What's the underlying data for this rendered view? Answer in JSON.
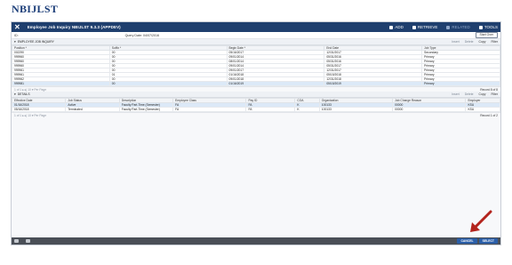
{
  "heading": "NBIJLST",
  "window": {
    "title": "Employee Job Inquiry NBIJLST 9.3.3 (APPDEV)",
    "tools": [
      {
        "label": "ADD",
        "icon": "add-icon",
        "enabled": true
      },
      {
        "label": "RETRIEVE",
        "icon": "retrieve-icon",
        "enabled": true
      },
      {
        "label": "RELATED",
        "icon": "related-icon",
        "enabled": false
      },
      {
        "label": "TOOLS",
        "icon": "gear-icon",
        "enabled": true
      }
    ]
  },
  "keyblock": {
    "id_label": "ID:",
    "query_date": "Query Date: 04/07/2016",
    "start_over": "Start Over"
  },
  "section1": {
    "title": "EMPLOYEE JOB INQUIRY",
    "actions": [
      "Insert",
      "Delete",
      "Copy",
      "Filter"
    ],
    "columns": [
      "Position *",
      "Suffix *",
      "Begin Date *",
      "End Date",
      "Job Type"
    ],
    "rows": [
      [
        "002290",
        "00",
        "05/16/2017",
        "12/31/2017",
        "Secondary"
      ],
      [
        "999960",
        "00",
        "09/01/2014",
        "05/31/2016",
        "Primary"
      ],
      [
        "999960",
        "00",
        "08/01/2014",
        "05/31/2016",
        "Primary"
      ],
      [
        "999960",
        "00",
        "09/01/2014",
        "05/31/2017",
        "Primary"
      ],
      [
        "999961",
        "00",
        "09/01/2017",
        "12/31/2017",
        "Primary"
      ],
      [
        "999961",
        "01",
        "01/16/2018",
        "05/15/2018",
        "Primary"
      ],
      [
        "999962",
        "00",
        "09/01/2018",
        "12/31/2018",
        "Primary"
      ],
      [
        "999981",
        "00",
        "01/16/2019",
        "05/15/2019",
        "Primary"
      ]
    ],
    "pager": "1 of 1 ▸ ▸| 10 ▾ Per Page",
    "record": "Record 8 of 8"
  },
  "section2": {
    "title": "DETAILS",
    "actions": [
      "Insert",
      "Delete",
      "Copy",
      "Filter"
    ],
    "columns": [
      "Effective Date",
      "Job Status",
      "Description",
      "Employee Class",
      "Pay ID",
      "COA",
      "Organization",
      "Job Change Reason",
      "Employer"
    ],
    "rows": [
      [
        "01/16/2018",
        "Active",
        "Faculty Part-Time (Semester)",
        "FA",
        "FA",
        "K",
        "100133",
        "00000",
        "KSU"
      ],
      [
        "05/16/2018",
        "Terminated",
        "Faculty Part-Time (Semester)",
        "FA",
        "FA",
        "K",
        "100133",
        "00000",
        "KSU"
      ]
    ],
    "pager": "1 of 1 ▸ ▸| 10 ▾ Per Page",
    "record": "Record 1 of 2"
  },
  "footer": {
    "cancel": "CANCEL",
    "select": "SELECT"
  },
  "colors": {
    "header_bg": "#1f3f6e",
    "accent_button": "#2a5ea8",
    "arrow": "#b3241d",
    "heading": "#1b3d78"
  }
}
